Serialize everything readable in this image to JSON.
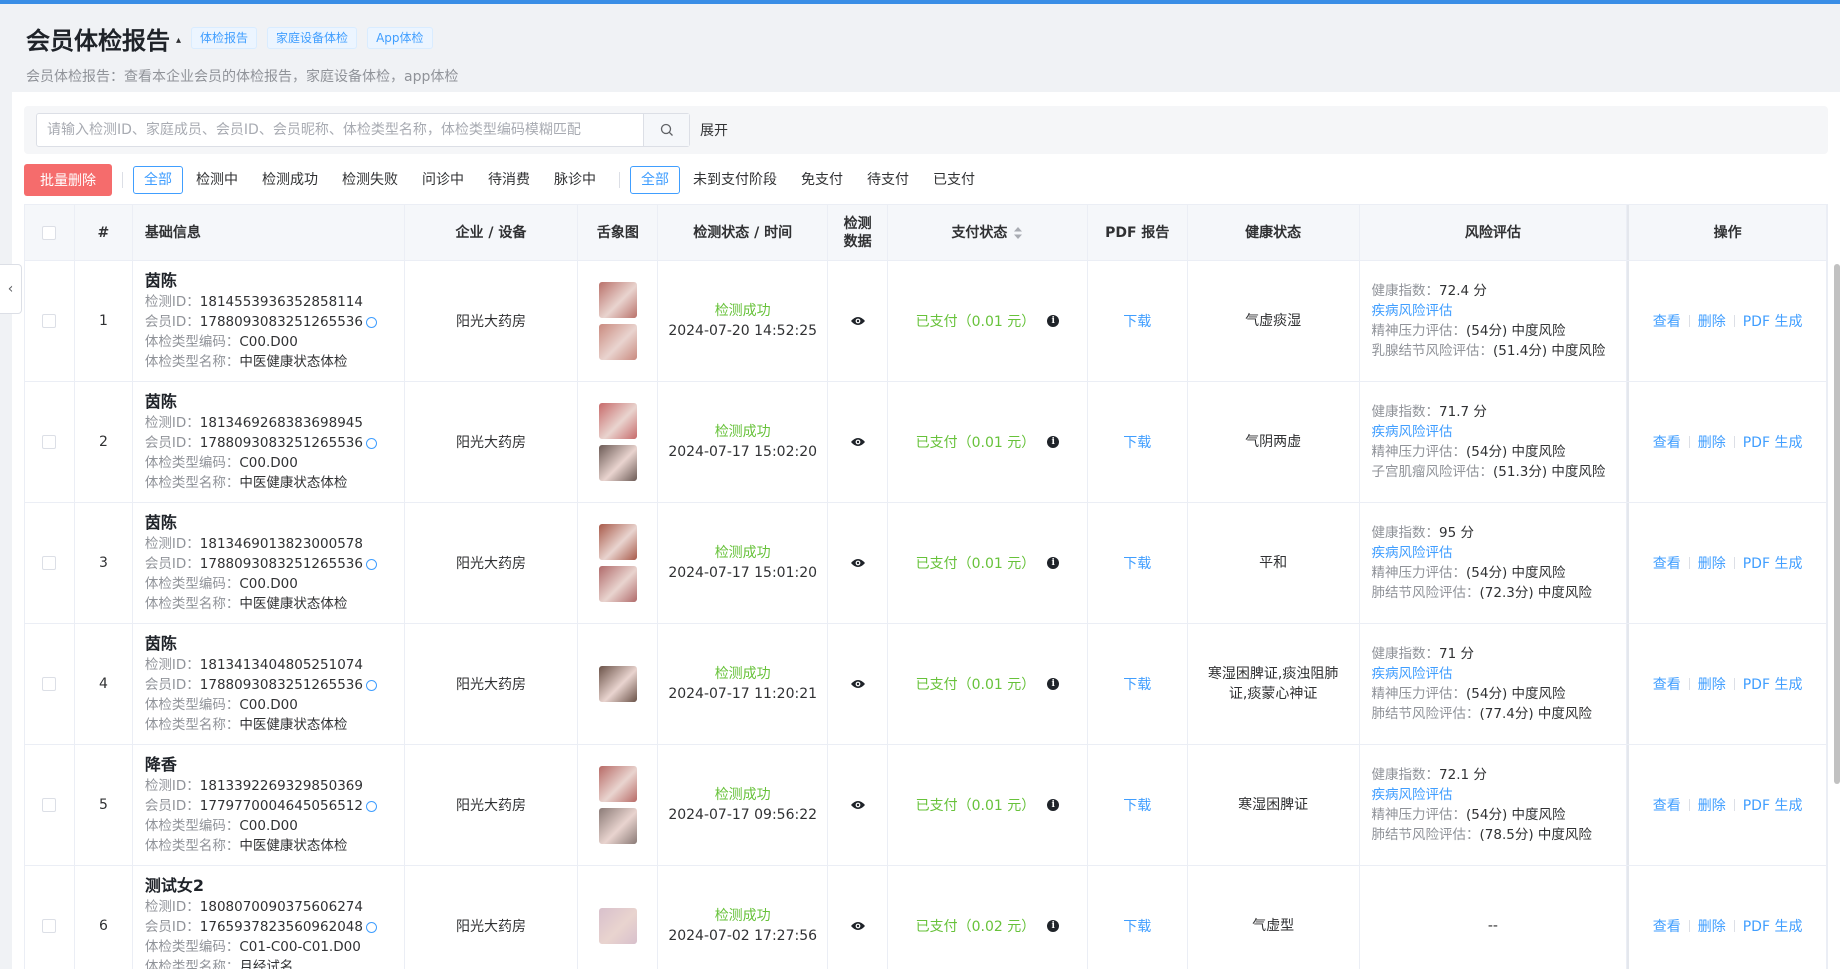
{
  "header": {
    "title": "会员体检报告",
    "caret": "▴",
    "tags": [
      "体检报告",
      "家庭设备体检",
      "App体检"
    ],
    "subtitle": "会员体检报告：查看本企业会员的体检报告，家庭设备体检，app体检"
  },
  "search": {
    "placeholder": "请输入检测ID、家庭成员、会员ID、会员昵称、体检类型名称，体检类型编码模糊匹配",
    "expand_label": "展开"
  },
  "filters": {
    "batch_delete": "批量删除",
    "status_filters": [
      "全部",
      "检测中",
      "检测成功",
      "检测失败",
      "问诊中",
      "待消费",
      "脉诊中"
    ],
    "pay_filters": [
      "全部",
      "未到支付阶段",
      "免支付",
      "待支付",
      "已支付"
    ]
  },
  "columns": {
    "index": "#",
    "basic": "基础信息",
    "company": "企业 / 设备",
    "tongue": "舌象图",
    "status_time": "检测状态 / 时间",
    "data": "检测数据",
    "pay": "支付状态",
    "pdf": "PDF 报告",
    "health": "健康状态",
    "risk": "风险评估",
    "ops": "操作"
  },
  "labels": {
    "detect_id": "检测ID：",
    "member_id": "会员ID：",
    "type_code": "体检类型编码：",
    "type_name": "体检类型名称：",
    "health_index": "健康指数：",
    "disease_risk": "疾病风险评估",
    "view": "查看",
    "delete": "删除",
    "pdf_gen": "PDF 生成",
    "download": "下载"
  },
  "rows": [
    {
      "index": "1",
      "name": "茵陈",
      "detect_id": "1814553936352858114",
      "member_id": "1788093083251265536",
      "type_code": "C00.D00",
      "type_name": "中医健康状态体检",
      "company": "阳光大药房",
      "status": "检测成功",
      "time": "2024-07-20 14:52:25",
      "pay": "已支付（0.01 元）",
      "health": "气虚痰湿",
      "health_index": "72.4 分",
      "risk1_label": "精神压力评估：",
      "risk1_val": "(54分) 中度风险",
      "risk2_label": "乳腺结节风险评估：",
      "risk2_val": "(51.4分) 中度风险",
      "imgs": 2
    },
    {
      "index": "2",
      "name": "茵陈",
      "detect_id": "1813469268383698945",
      "member_id": "1788093083251265536",
      "type_code": "C00.D00",
      "type_name": "中医健康状态体检",
      "company": "阳光大药房",
      "status": "检测成功",
      "time": "2024-07-17 15:02:20",
      "pay": "已支付（0.01 元）",
      "health": "气阴两虚",
      "health_index": "71.7 分",
      "risk1_label": "精神压力评估：",
      "risk1_val": "(54分) 中度风险",
      "risk2_label": "子宫肌瘤风险评估：",
      "risk2_val": "(51.3分) 中度风险",
      "imgs": 2
    },
    {
      "index": "3",
      "name": "茵陈",
      "detect_id": "1813469013823000578",
      "member_id": "1788093083251265536",
      "type_code": "C00.D00",
      "type_name": "中医健康状态体检",
      "company": "阳光大药房",
      "status": "检测成功",
      "time": "2024-07-17 15:01:20",
      "pay": "已支付（0.01 元）",
      "health": "平和",
      "health_index": "95 分",
      "risk1_label": "精神压力评估：",
      "risk1_val": "(54分) 中度风险",
      "risk2_label": "肺结节风险评估：",
      "risk2_val": "(72.3分) 中度风险",
      "imgs": 2
    },
    {
      "index": "4",
      "name": "茵陈",
      "detect_id": "1813413404805251074",
      "member_id": "1788093083251265536",
      "type_code": "C00.D00",
      "type_name": "中医健康状态体检",
      "company": "阳光大药房",
      "status": "检测成功",
      "time": "2024-07-17 11:20:21",
      "pay": "已支付（0.01 元）",
      "health": "寒湿困脾证,痰浊阻肺证,痰蒙心神证",
      "health_index": "71 分",
      "risk1_label": "精神压力评估：",
      "risk1_val": "(54分) 中度风险",
      "risk2_label": "肺结节风险评估：",
      "risk2_val": "(77.4分) 中度风险",
      "imgs": 1
    },
    {
      "index": "5",
      "name": "降香",
      "detect_id": "1813392269329850369",
      "member_id": "1779770004645056512",
      "type_code": "C00.D00",
      "type_name": "中医健康状态体检",
      "company": "阳光大药房",
      "status": "检测成功",
      "time": "2024-07-17 09:56:22",
      "pay": "已支付（0.01 元）",
      "health": "寒湿困脾证",
      "health_index": "72.1 分",
      "risk1_label": "精神压力评估：",
      "risk1_val": "(54分) 中度风险",
      "risk2_label": "肺结节风险评估：",
      "risk2_val": "(78.5分) 中度风险",
      "imgs": 2
    },
    {
      "index": "6",
      "name": "测试女2",
      "detect_id": "1808070090375606274",
      "member_id": "1765937823560962048",
      "type_code": "C01-C00-C01.D00",
      "type_name": "月经试名",
      "company": "阳光大药房",
      "status": "检测成功",
      "time": "2024-07-02 17:27:56",
      "pay": "已支付（0.02 元）",
      "health": "气虚型",
      "risk_empty": "--",
      "imgs": 1
    }
  ],
  "colors": {
    "primary": "#409eff",
    "success": "#67c23a",
    "danger": "#f56c6c"
  }
}
